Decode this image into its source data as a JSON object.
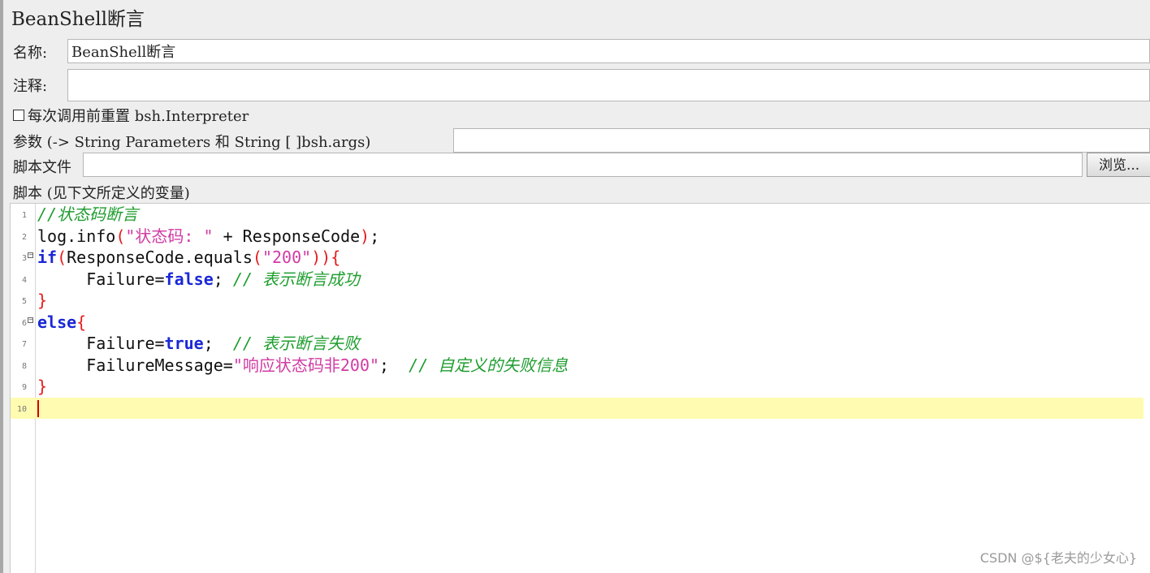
{
  "window": {
    "title": "BeanShell断言"
  },
  "form": {
    "name_label": "名称:",
    "name_value": "BeanShell断言",
    "comment_label": "注释:",
    "comment_value": "",
    "reset_label": "每次调用前重置 bsh.Interpreter",
    "params_label": "参数 (-> String Parameters 和 String [ ]bsh.args)",
    "params_value": "",
    "script_file_label": "脚本文件",
    "script_file_value": "",
    "browse_label": "浏览...",
    "script_label": "脚本 (见下文所定义的变量)"
  },
  "editor": {
    "lines": [
      {
        "num": "1",
        "fold": "",
        "tokens": [
          {
            "t": "//状态码断言",
            "c": "cm"
          }
        ]
      },
      {
        "num": "2",
        "fold": "",
        "tokens": [
          {
            "t": "log.info",
            "c": "pl"
          },
          {
            "t": "(",
            "c": "br"
          },
          {
            "t": "\"状态码: \"",
            "c": "str"
          },
          {
            "t": " + ResponseCode",
            "c": "pl"
          },
          {
            "t": ")",
            "c": "br"
          },
          {
            "t": ";",
            "c": "pl"
          }
        ]
      },
      {
        "num": "3",
        "fold": "−",
        "tokens": [
          {
            "t": "if",
            "c": "kw"
          },
          {
            "t": "(",
            "c": "br"
          },
          {
            "t": "ResponseCode.equals",
            "c": "pl"
          },
          {
            "t": "(",
            "c": "br"
          },
          {
            "t": "\"200\"",
            "c": "str"
          },
          {
            "t": "))",
            "c": "br"
          },
          {
            "t": "{",
            "c": "br"
          }
        ]
      },
      {
        "num": "4",
        "fold": "",
        "tokens": [
          {
            "t": "     Failure=",
            "c": "pl"
          },
          {
            "t": "false",
            "c": "kw"
          },
          {
            "t": "; ",
            "c": "pl"
          },
          {
            "t": "// 表示断言成功",
            "c": "cm"
          }
        ]
      },
      {
        "num": "5",
        "fold": "",
        "tokens": [
          {
            "t": "}",
            "c": "br"
          }
        ]
      },
      {
        "num": "6",
        "fold": "−",
        "tokens": [
          {
            "t": "else",
            "c": "kw"
          },
          {
            "t": "{",
            "c": "br"
          }
        ]
      },
      {
        "num": "7",
        "fold": "",
        "tokens": [
          {
            "t": "     Failure=",
            "c": "pl"
          },
          {
            "t": "true",
            "c": "kw"
          },
          {
            "t": ";  ",
            "c": "pl"
          },
          {
            "t": "// 表示断言失败",
            "c": "cm"
          }
        ]
      },
      {
        "num": "8",
        "fold": "",
        "tokens": [
          {
            "t": "     FailureMessage=",
            "c": "pl"
          },
          {
            "t": "\"响应状态码非200\"",
            "c": "str"
          },
          {
            "t": ";  ",
            "c": "pl"
          },
          {
            "t": "// 自定义的失败信息",
            "c": "cm"
          }
        ]
      },
      {
        "num": "9",
        "fold": "",
        "tokens": [
          {
            "t": "}",
            "c": "br"
          }
        ]
      },
      {
        "num": "10",
        "fold": "",
        "tokens": []
      }
    ],
    "current_line": "10",
    "colors": {
      "comment": "#1f9d2f",
      "keyword": "#1a28d6",
      "string": "#d13ba3",
      "bracket": "#e41b1b",
      "current_line_bg": "#fffbb0"
    }
  },
  "watermark": "CSDN @${老夫的少女心}",
  "icons": {
    "reset_checkbox": "checkbox-unchecked-icon",
    "fold_marker": "fold-minus-icon"
  }
}
